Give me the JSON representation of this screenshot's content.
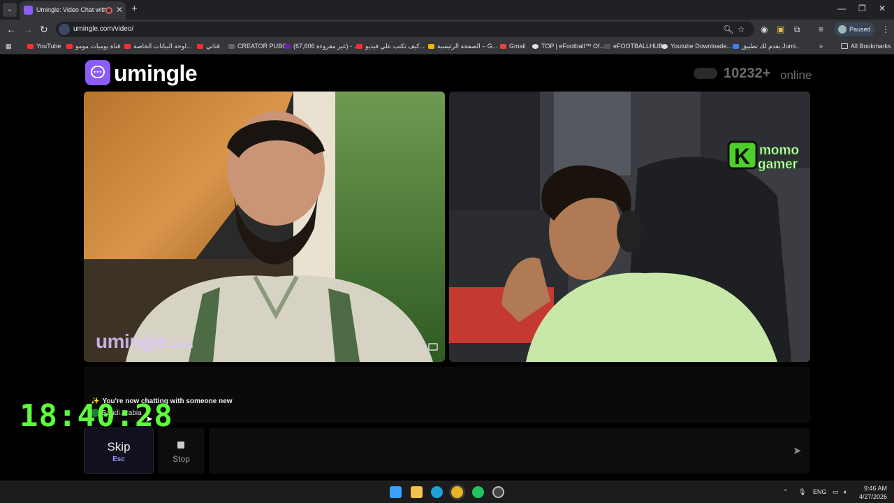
{
  "browser": {
    "tab_title": "Umingle: Video Chat with S",
    "tab_list_glyph": "⌄",
    "new_tab_glyph": "+",
    "close_glyph": "✕",
    "url": "umingle.com/video/",
    "profile_status": "Paused",
    "window_controls": [
      "—",
      "❐",
      "✕"
    ]
  },
  "bookmarks": {
    "items": [
      {
        "label": "YouTube",
        "color": "#ff2d2d"
      },
      {
        "label": "قناة يوميات مومو",
        "color": "#ff2d2d"
      },
      {
        "label": "لوحة البيانات الخاصة...",
        "color": "#ff2d2d"
      },
      {
        "label": "قناتي",
        "color": "#ff2d2d"
      },
      {
        "label": "CREATOR PUBG",
        "color": "#222222"
      },
      {
        "label": "(67,606 غير مقروءة) - ...",
        "color": "#6b21a8"
      },
      {
        "label": "كيف تكتب علي فيديو...",
        "color": "#ff2d2d"
      },
      {
        "label": "الصفحة الرئيسية – G...",
        "color": "#f4b400"
      },
      {
        "label": "Gmail",
        "color": "#ea4335"
      },
      {
        "label": "TOP | eFootball™ Of...",
        "color": "#e0e0e0"
      },
      {
        "label": "eFOOTBALLHUB",
        "color": "#222222"
      },
      {
        "label": "Youtube Downloade...",
        "color": "#e0e0e0"
      },
      {
        "label": "يقدم لك تطبيق Jumi...",
        "color": "#3b82f6"
      }
    ],
    "overflow": "»",
    "all_bookmarks": "All Bookmarks"
  },
  "site": {
    "logo_text": "umingle",
    "online_count": "10232+",
    "online_label": "online",
    "brand_color": "#8b5cf6"
  },
  "videos": {
    "watermark": "umingle",
    "watermark_suffix": ".com",
    "overlay_logo": [
      "momo",
      "gamer"
    ],
    "overlay_logo_mark": "K"
  },
  "chat": {
    "sparkle": "✨",
    "message": "You're now chatting with someone new",
    "country": "Saudi Arabia",
    "input_placeholder": ""
  },
  "controls": {
    "skip_label": "Skip",
    "skip_key": "Esc",
    "stop_label": "Stop",
    "send_glyph": "➤"
  },
  "overlay": {
    "clock": "18:40:28"
  },
  "taskbar": {
    "language": "ENG",
    "time": "9:46 AM",
    "date": "4/27/2026"
  }
}
